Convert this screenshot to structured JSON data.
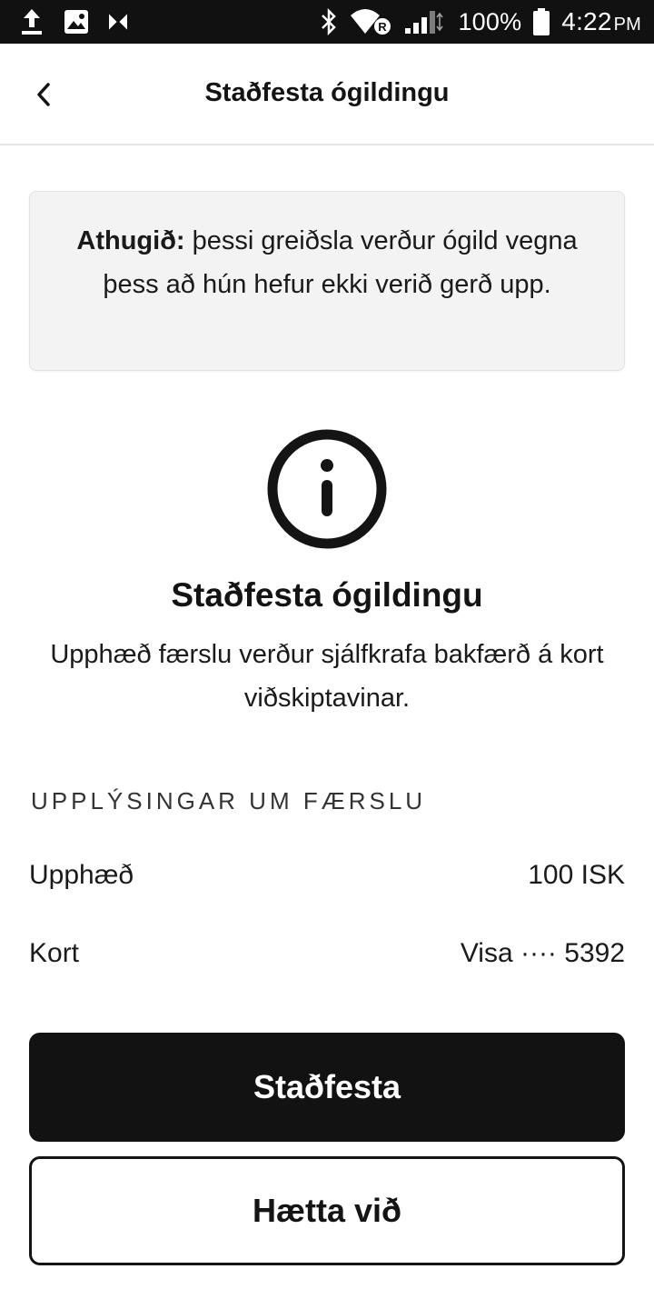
{
  "status_bar": {
    "battery": "100%",
    "time": "4:22",
    "ampm": "PM",
    "icons": [
      "upload-icon",
      "image-icon",
      "app-icon",
      "bluetooth-icon",
      "wifi-icon",
      "signal-icon",
      "battery-icon"
    ]
  },
  "header": {
    "title": "Staðfesta ógildingu",
    "back_icon": "chevron-left-icon"
  },
  "notice": {
    "bold": "Athugið:",
    "text": " þessi greiðsla verður ógild vegna þess að hún hefur ekki verið gerð upp."
  },
  "main": {
    "icon": "info-icon",
    "heading": "Staðfesta ógildingu",
    "description": "Upphæð færslu verður sjálfkrafa bakfærð á kort viðskiptavinar."
  },
  "details": {
    "section_label": "UPPLÝSINGAR UM FÆRSLU",
    "rows": [
      {
        "label": "Upphæð",
        "value": "100 ISK"
      },
      {
        "label": "Kort",
        "value": "Visa ···· 5392"
      }
    ]
  },
  "actions": {
    "confirm_label": "Staðfesta",
    "cancel_label": "Hætta við"
  }
}
